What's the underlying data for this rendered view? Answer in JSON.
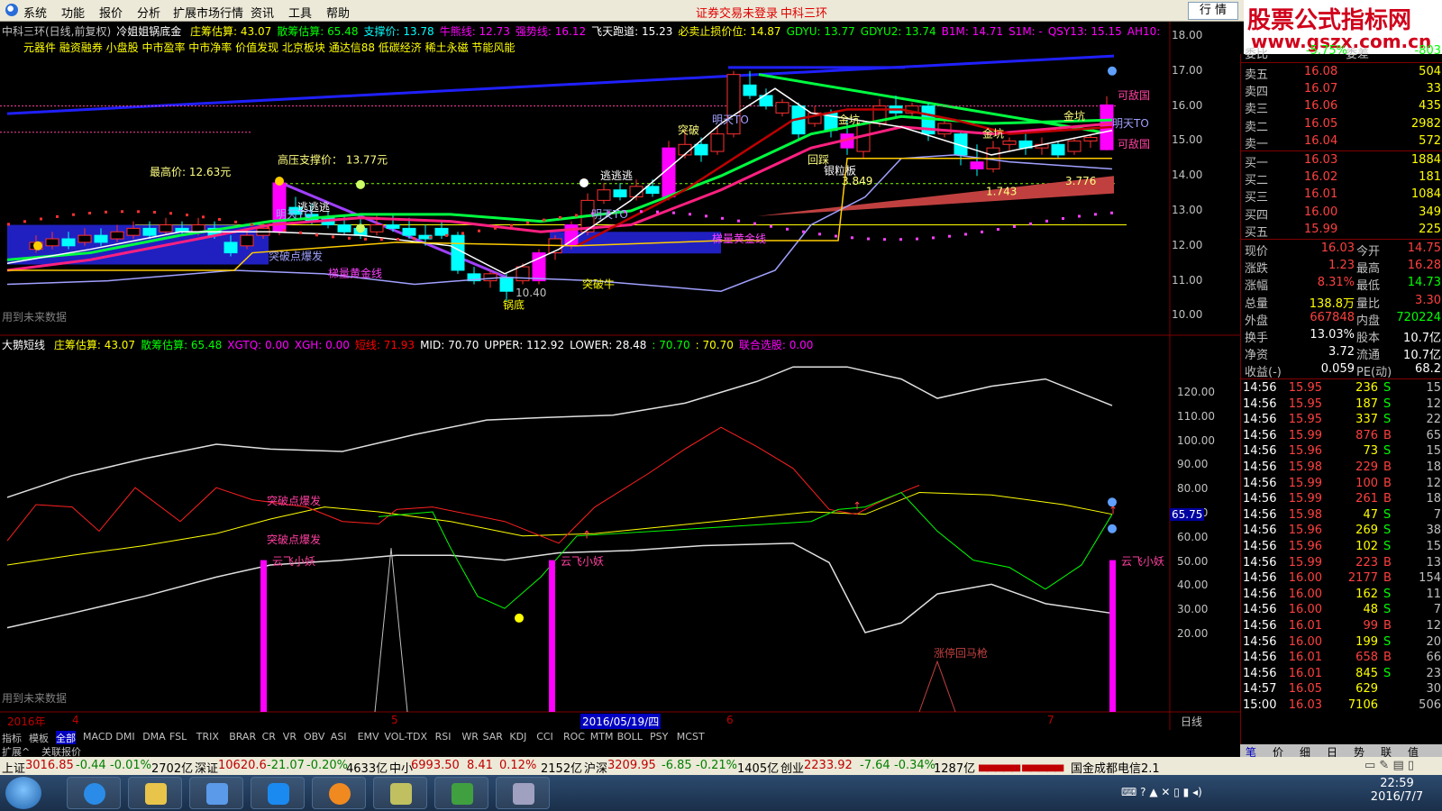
{
  "menu": {
    "items": [
      "系统",
      "功能",
      "报价",
      "分析",
      "扩展市场行情",
      "资讯",
      "工具",
      "帮助"
    ],
    "center_status": "证券交易未登录",
    "center_stock": "中科三环",
    "mode_button": "行 情"
  },
  "banner": {
    "line1": "股票公式指标网",
    "line2": "www.gszx.com.cn"
  },
  "main_chart": {
    "title": "中科三环(日线,前复权)",
    "formula": "冷姐姐锅底金",
    "indicators": [
      {
        "label": "庄筹估算: 43.07",
        "color": "#ffff00"
      },
      {
        "label": "散筹估算: 65.48",
        "color": "#00ff00"
      },
      {
        "label": "支撑价: 13.78",
        "color": "#00ffff"
      },
      {
        "label": "牛熊线: 12.73",
        "color": "#ff00ff"
      },
      {
        "label": "强势线: 16.12",
        "color": "#ff00ff"
      },
      {
        "label": "飞天跑道: 15.23",
        "color": "#ffffff"
      },
      {
        "label": "必卖止损价位: 14.87",
        "color": "#ffff00"
      },
      {
        "label": "GDYU: 13.77",
        "color": "#00ff00"
      },
      {
        "label": "GDYU2: 13.74",
        "color": "#00ff00"
      },
      {
        "label": "B1M: 14.71",
        "color": "#ff00ff"
      },
      {
        "label": "S1M: -",
        "color": "#ff00ff"
      },
      {
        "label": "QSY13: 15.15",
        "color": "#ff00ff"
      },
      {
        "label": "AH10:",
        "color": "#ff00ff"
      }
    ],
    "tag_line": "元器件 融资融券 小盘股 中市盈率 中市净率 价值发现 北京板块 通达信88 低碳经济 稀土永磁 节能风能",
    "y_axis": [
      "18.00",
      "17.00",
      "16.00",
      "15.00",
      "14.00",
      "13.00",
      "12.00",
      "11.00",
      "10.00"
    ],
    "annotations": {
      "high_support": "高压支撑价： 13.77元",
      "max_price": "最高价: 12.63元",
      "breakout": "突破",
      "golden_pit": "金坑",
      "golden_pit2": "金坑",
      "golden_pit3": "金坑",
      "escape": "逃逃逃",
      "escape2": "逃逃逃",
      "tomorrow_to": "明天TO",
      "tomorrow_to2": "明天TO",
      "tomorrow_to3": "明天TO",
      "tomorrow_to4": "明天TO",
      "rich_country": "可敌国",
      "rich_country2": "可敌国",
      "break_explode": "突破点爆发",
      "ladder_gold": "梯量黄金线",
      "ladder_gold2": "梯量黄金线",
      "pot_bottom": "锅底",
      "low_price": "10.40",
      "breakout_bull": "突破牛",
      "v1": "3.849",
      "v2": "1.743",
      "v3": "3.776",
      "silver_board": "银粒板",
      "return": "回踩",
      "future_data": "用到未来数据"
    }
  },
  "sub_chart": {
    "title": "大鹅短线",
    "indicators": [
      {
        "label": "庄筹估算: 43.07",
        "color": "#ffff00"
      },
      {
        "label": "散筹估算: 65.48",
        "color": "#00ff00"
      },
      {
        "label": "XGTQ: 0.00",
        "color": "#ff00ff"
      },
      {
        "label": "XGH: 0.00",
        "color": "#ff00ff"
      },
      {
        "label": "短线: 71.93",
        "color": "#ff0000"
      },
      {
        "label": "MID: 70.70",
        "color": "#ffffff"
      },
      {
        "label": "UPPER: 112.92",
        "color": "#ffffff"
      },
      {
        "label": "LOWER: 28.48",
        "color": "#ffffff"
      },
      {
        "label": ": 70.70",
        "color": "#00ff00"
      },
      {
        "label": ": 70.70",
        "color": "#ffff00"
      },
      {
        "label": "联合选股: 0.00",
        "color": "#ff00ff"
      }
    ],
    "y_axis": [
      "120.00",
      "110.00",
      "100.00",
      "90.00",
      "80.00",
      "70.00",
      "60.00",
      "50.00",
      "40.00",
      "30.00",
      "20.00"
    ],
    "current_value": "65.75",
    "annotations": {
      "break1": "突破点爆发",
      "break2": "突破点爆发",
      "cloud1": "云飞小妖",
      "cloud2": "云飞小妖",
      "cloud3": "云飞小妖",
      "limitup": "涨停回马枪",
      "future_data": "用到未来数据"
    }
  },
  "x_axis": {
    "labels": [
      "2016年",
      "4",
      "5",
      "2016/05/19/四",
      "6",
      "7"
    ],
    "period": "日线"
  },
  "tabs": [
    "指标",
    "模板",
    "全部",
    "MACD",
    "DMI",
    "DMA",
    "FSL",
    "TRIX",
    "BRAR",
    "CR",
    "VR",
    "OBV",
    "ASI",
    "EMV",
    "VOL-TDX",
    "RSI",
    "WR",
    "SAR",
    "KDJ",
    "CCI",
    "ROC",
    "MTM",
    "BOLL",
    "PSY",
    "MCST"
  ],
  "tabs2": [
    "扩展^",
    "关联报价"
  ],
  "quote": {
    "top_row": [
      "委比",
      "-5.75%",
      "委差",
      "-803"
    ],
    "asks": [
      {
        "label": "卖五",
        "price": "16.08",
        "vol": "504"
      },
      {
        "label": "卖四",
        "price": "16.07",
        "vol": "33"
      },
      {
        "label": "卖三",
        "price": "16.06",
        "vol": "435"
      },
      {
        "label": "卖二",
        "price": "16.05",
        "vol": "2982"
      },
      {
        "label": "卖一",
        "price": "16.04",
        "vol": "572"
      }
    ],
    "bids": [
      {
        "label": "买一",
        "price": "16.03",
        "vol": "1884"
      },
      {
        "label": "买二",
        "price": "16.02",
        "vol": "181"
      },
      {
        "label": "买三",
        "price": "16.01",
        "vol": "1084"
      },
      {
        "label": "买四",
        "price": "16.00",
        "vol": "349"
      },
      {
        "label": "买五",
        "price": "15.99",
        "vol": "225"
      }
    ],
    "stats": [
      {
        "l1": "现价",
        "v1": "16.03",
        "l2": "今开",
        "v2": "14.75",
        "c1": "#ff4040",
        "c2": "#ff4040"
      },
      {
        "l1": "涨跌",
        "v1": "1.23",
        "l2": "最高",
        "v2": "16.28",
        "c1": "#ff4040",
        "c2": "#ff4040"
      },
      {
        "l1": "涨幅",
        "v1": "8.31%",
        "l2": "最低",
        "v2": "14.73",
        "c1": "#ff4040",
        "c2": "#00ff00"
      },
      {
        "l1": "总量",
        "v1": "138.8万",
        "l2": "量比",
        "v2": "3.30",
        "c1": "#ffff00",
        "c2": "#ff4040"
      },
      {
        "l1": "外盘",
        "v1": "667848",
        "l2": "内盘",
        "v2": "720224",
        "c1": "#ff4040",
        "c2": "#00ff00"
      },
      {
        "l1": "换手",
        "v1": "13.03%",
        "l2": "股本",
        "v2": "10.7亿",
        "c1": "#ffffff",
        "c2": "#ffffff"
      },
      {
        "l1": "净资",
        "v1": "3.72",
        "l2": "流通",
        "v2": "10.7亿",
        "c1": "#ffffff",
        "c2": "#ffffff"
      },
      {
        "l1": "收益(-)",
        "v1": "0.059",
        "l2": "PE(动)",
        "v2": "68.2",
        "c1": "#ffffff",
        "c2": "#ffffff"
      }
    ],
    "ticks": [
      {
        "t": "14:56",
        "p": "15.95",
        "v": "236",
        "s": "S",
        "n": "15"
      },
      {
        "t": "14:56",
        "p": "15.95",
        "v": "187",
        "s": "S",
        "n": "12"
      },
      {
        "t": "14:56",
        "p": "15.95",
        "v": "337",
        "s": "S",
        "n": "22"
      },
      {
        "t": "14:56",
        "p": "15.99",
        "v": "876",
        "s": "B",
        "n": "65"
      },
      {
        "t": "14:56",
        "p": "15.96",
        "v": "73",
        "s": "S",
        "n": "15"
      },
      {
        "t": "14:56",
        "p": "15.98",
        "v": "229",
        "s": "B",
        "n": "18"
      },
      {
        "t": "14:56",
        "p": "15.99",
        "v": "100",
        "s": "B",
        "n": "12"
      },
      {
        "t": "14:56",
        "p": "15.99",
        "v": "261",
        "s": "B",
        "n": "18"
      },
      {
        "t": "14:56",
        "p": "15.98",
        "v": "47",
        "s": "S",
        "n": "7"
      },
      {
        "t": "14:56",
        "p": "15.96",
        "v": "269",
        "s": "S",
        "n": "38"
      },
      {
        "t": "14:56",
        "p": "15.96",
        "v": "102",
        "s": "S",
        "n": "15"
      },
      {
        "t": "14:56",
        "p": "15.99",
        "v": "223",
        "s": "B",
        "n": "13"
      },
      {
        "t": "14:56",
        "p": "16.00",
        "v": "2177",
        "s": "B",
        "n": "154"
      },
      {
        "t": "14:56",
        "p": "16.00",
        "v": "162",
        "s": "S",
        "n": "11"
      },
      {
        "t": "14:56",
        "p": "16.00",
        "v": "48",
        "s": "S",
        "n": "7"
      },
      {
        "t": "14:56",
        "p": "16.01",
        "v": "99",
        "s": "B",
        "n": "12"
      },
      {
        "t": "14:56",
        "p": "16.00",
        "v": "199",
        "s": "S",
        "n": "20"
      },
      {
        "t": "14:56",
        "p": "16.01",
        "v": "658",
        "s": "B",
        "n": "66"
      },
      {
        "t": "14:56",
        "p": "16.01",
        "v": "845",
        "s": "S",
        "n": "23"
      },
      {
        "t": "14:57",
        "p": "16.05",
        "v": "629",
        "s": "",
        "n": "30"
      },
      {
        "t": "15:00",
        "p": "16.03",
        "v": "7106",
        "s": "",
        "n": "506"
      }
    ],
    "bottom_tabs": [
      "笔",
      "价",
      "细",
      "日",
      "势",
      "联",
      "值"
    ]
  },
  "status": {
    "sh_label": "上证",
    "sh_val": "3016.85",
    "sh_chg": "-0.44",
    "sh_pct": "-0.01%",
    "sh_amt": "2702亿",
    "sz_label": "深证",
    "sz_val": "10620.6",
    "sz_chg": "-21.07",
    "sz_pct": "-0.20%",
    "sz_amt": "4633亿",
    "zx_label": "中小",
    "zx_val": "6993.50",
    "zx_chg": "8.41",
    "zx_pct": "0.12%",
    "zx_amt": "2152亿",
    "hs_label": "沪深",
    "hs_val": "3209.95",
    "hs_chg": "-6.85",
    "hs_pct": "-0.21%",
    "hs_amt": "1405亿",
    "cy_label": "创业",
    "cy_val": "2233.92",
    "cy_chg": "-7.64",
    "cy_pct": "-0.34%",
    "cy_amt": "1287亿",
    "broker": "国金成都电信2.1"
  },
  "taskbar": {
    "time": "22:59",
    "date": "2016/7/7"
  }
}
